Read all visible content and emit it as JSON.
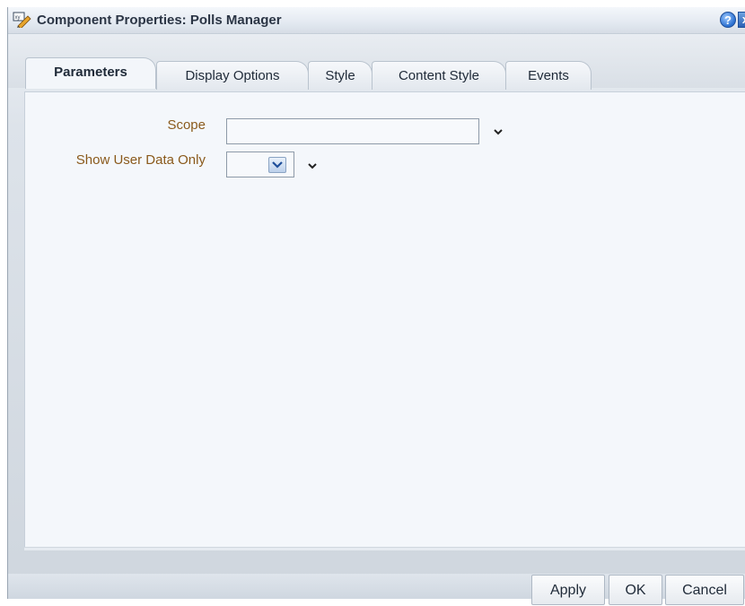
{
  "window": {
    "title": "Component Properties: Polls Manager",
    "help_glyph": "?",
    "close_glyph": "x"
  },
  "tabs": [
    {
      "label": "Parameters",
      "active": true
    },
    {
      "label": "Display Options",
      "active": false
    },
    {
      "label": "Style",
      "active": false
    },
    {
      "label": "Content Style",
      "active": false
    },
    {
      "label": "Events",
      "active": false
    }
  ],
  "form": {
    "scope_label": "Scope",
    "scope_value": "",
    "show_user_data_label": "Show User Data Only",
    "show_user_data_value": ""
  },
  "buttons": {
    "apply": "Apply",
    "ok": "OK",
    "cancel": "Cancel"
  },
  "icons": {
    "app": "component-properties-icon",
    "help": "help-icon",
    "close": "close-icon",
    "dropdown": "chevron-down-icon"
  },
  "colors": {
    "label_text": "#8a5a1c",
    "panel_bg": "#f4f7fb",
    "help_blue": "#2a6fd0"
  }
}
